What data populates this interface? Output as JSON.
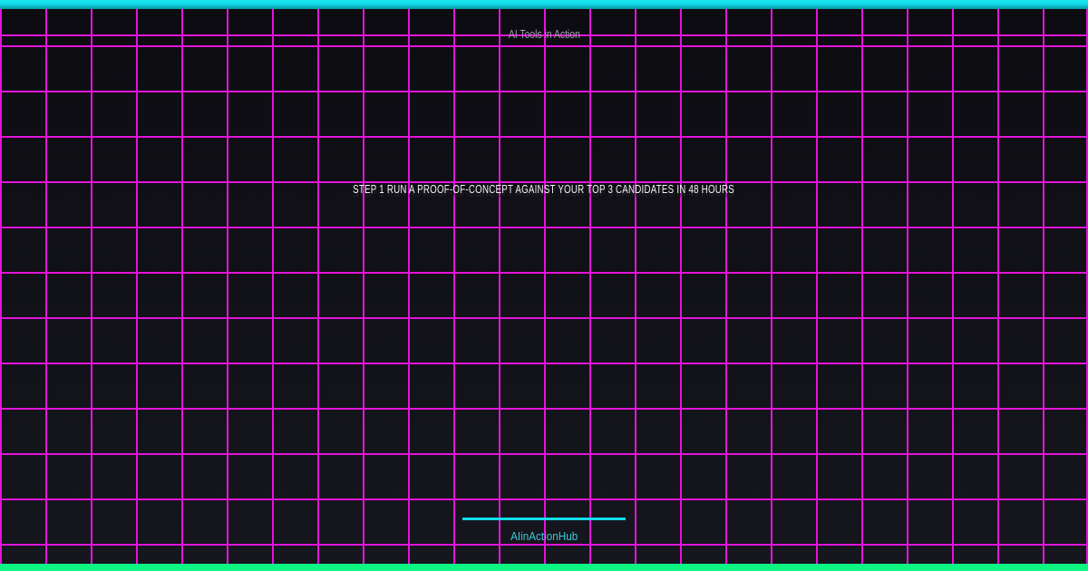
{
  "banner": {
    "kicker": "AI Tools in Action",
    "title": "STEP 1 RUN A PROOF-OF-CONCEPT AGAINST YOUR TOP 3 CANDIDATES IN 48 HOURS",
    "brand": "AIinActionHub"
  },
  "colors": {
    "accent_cyan": "#12dce9",
    "accent_cyan_dark": "#0a93a0",
    "accent_green": "#0ef584",
    "grid_magenta": "#e513da",
    "title_white": "#f4f4f6",
    "kicker_gray": "#9da0a8",
    "brand_cyan": "#38cbd6",
    "background_top": "#0c0c11",
    "background_bottom": "#16161e",
    "shadow_dark": "#24242b"
  }
}
